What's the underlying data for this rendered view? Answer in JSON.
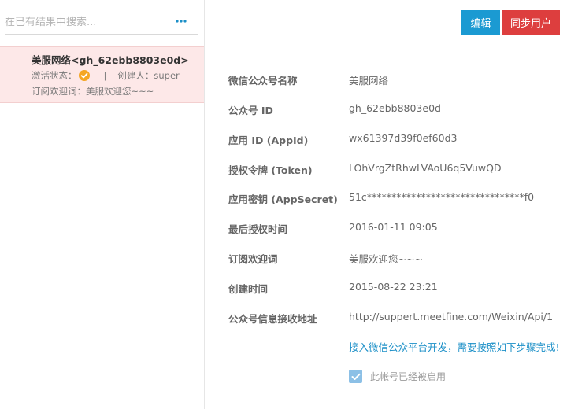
{
  "search": {
    "placeholder": "在已有结果中搜索...",
    "more_icon": "ellipsis-icon"
  },
  "list": {
    "items": [
      {
        "title": "美服网络<gh_62ebb8803e0d>",
        "status_label": "激活状态：",
        "status_icon": "check-circle-icon",
        "status_color": "#f5a623",
        "separator": "|",
        "creator": "创建人：super",
        "welcome": "订阅欢迎词：美服欢迎您~~~"
      }
    ]
  },
  "toolbar": {
    "edit_label": "编辑",
    "sync_label": "同步用户",
    "edit_color": "#1b9ad2",
    "sync_color": "#dd3e3e"
  },
  "details": {
    "rows": [
      {
        "label": "微信公众号名称",
        "value": "美服网络"
      },
      {
        "label": "公众号 ID",
        "value": "gh_62ebb8803e0d"
      },
      {
        "label": "应用 ID (AppId)",
        "value": "wx61397d39f0ef60d3"
      },
      {
        "label": "授权令牌 (Token)",
        "value": "LOhVrgZtRhwLVAoU6q5VuwQD"
      },
      {
        "label": "应用密钥 (AppSecret)",
        "value": "51c********************************f0"
      },
      {
        "label": "最后授权时间",
        "value": "2016-01-11 09:05"
      },
      {
        "label": "订阅欢迎词",
        "value": "美服欢迎您~~~"
      },
      {
        "label": "创建时间",
        "value": "2015-08-22 23:21"
      },
      {
        "label": "公众号信息接收地址",
        "value": "http://suppert.meetfine.com/Weixin/Api/1"
      }
    ],
    "help_link": "接入微信公众平台开发，需要按照如下步骤完成!",
    "enabled_label": "此帐号已经被启用",
    "enabled_checked": true
  }
}
